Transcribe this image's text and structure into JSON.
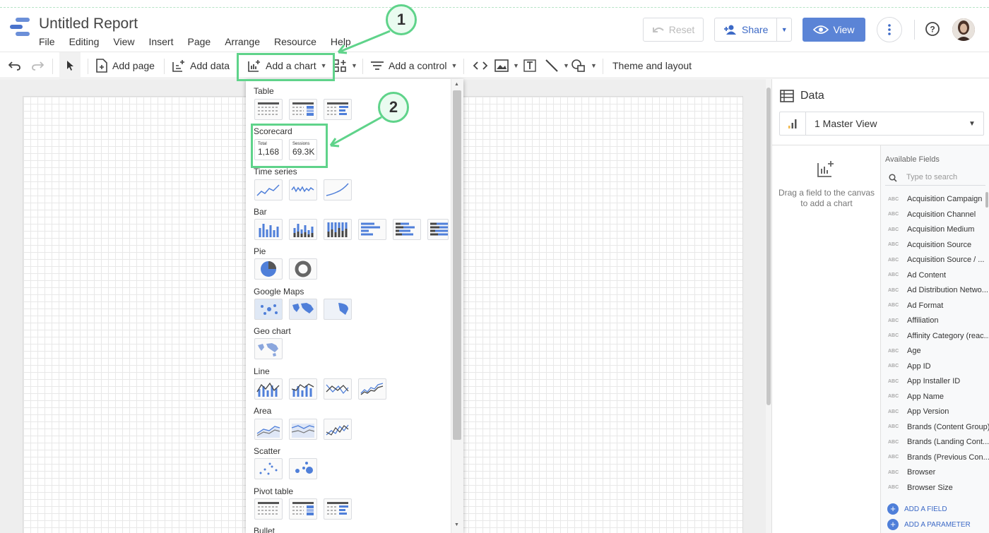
{
  "app": {
    "title": "Untitled Report",
    "menu": [
      "File",
      "Editing",
      "View",
      "Insert",
      "Page",
      "Arrange",
      "Resource",
      "Help"
    ],
    "reset_label": "Reset",
    "share_label": "Share",
    "view_label": "View"
  },
  "toolbar": {
    "add_page": "Add page",
    "add_data": "Add data",
    "add_chart": "Add a chart",
    "add_control": "Add a control",
    "theme": "Theme and layout"
  },
  "chart_menu": {
    "sections": [
      "Table",
      "Scorecard",
      "Time series",
      "Bar",
      "Pie",
      "Google Maps",
      "Geo chart",
      "Line",
      "Area",
      "Scatter",
      "Pivot table",
      "Bullet"
    ],
    "scorecards": [
      {
        "label": "Total",
        "value": "1,168"
      },
      {
        "label": "Sessions",
        "value": "69.3K"
      }
    ]
  },
  "annotations": [
    "1",
    "2"
  ],
  "data_panel": {
    "title": "Data",
    "data_source": "1 Master View",
    "drag_hint": "Drag a field to the canvas to add a chart",
    "available_fields_label": "Available Fields",
    "search_placeholder": "Type to search",
    "field_type_badge": "ABC",
    "fields": [
      "Acquisition Campaign",
      "Acquisition Channel",
      "Acquisition Medium",
      "Acquisition Source",
      "Acquisition Source / ...",
      "Ad Content",
      "Ad Distribution Netwo...",
      "Ad Format",
      "Affiliation",
      "Affinity Category (reac...",
      "Age",
      "App ID",
      "App Installer ID",
      "App Name",
      "App Version",
      "Brands (Content Group)",
      "Brands (Landing Cont...",
      "Brands (Previous Con...",
      "Browser",
      "Browser Size"
    ],
    "add_field": "ADD A FIELD",
    "add_parameter": "ADD A PARAMETER"
  },
  "colors": {
    "accent": "#5b84d6",
    "annotation": "#5fd38a",
    "link": "#3c69c6"
  }
}
